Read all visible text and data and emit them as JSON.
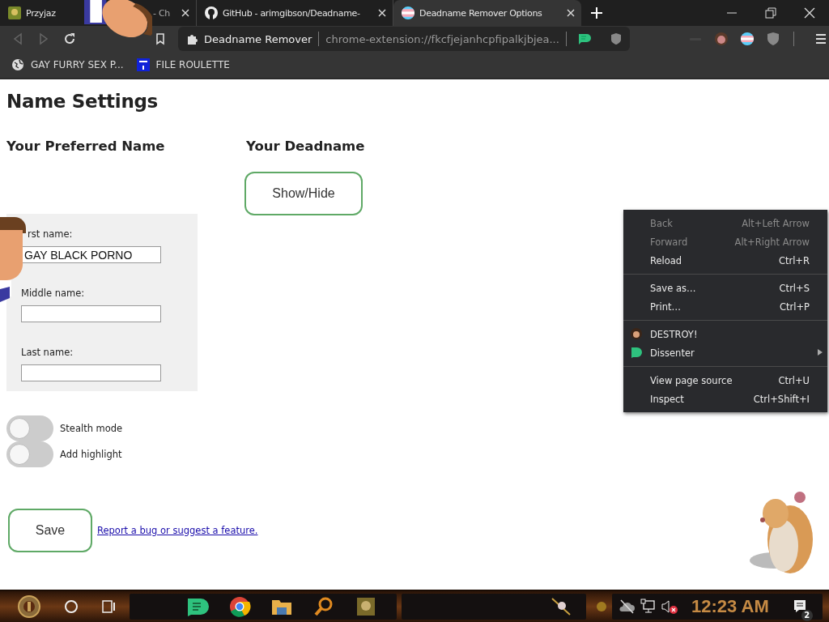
{
  "tabs": [
    {
      "title": "Przyjaz",
      "title_end": "- Ch",
      "kind": "site",
      "selected": false
    },
    {
      "title": "GitHub - arimgibson/Deadname-",
      "kind": "github",
      "selected": false
    },
    {
      "title": "Deadname Remover Options",
      "kind": "flag",
      "selected": true
    }
  ],
  "address_bar": {
    "site": "Deadname Remover",
    "url": "chrome-extension://fkcfjejanhcpfipalkjbjea..."
  },
  "bookmarks": [
    {
      "label": "GAY FURRY SEX P...",
      "kind": "globe"
    },
    {
      "label": "FILE ROULETTE",
      "kind": "badge"
    }
  ],
  "page": {
    "title": "Name Settings",
    "sections": [
      "Your Preferred Name",
      "Your Deadname"
    ],
    "show_hide_button": "Show/Hide",
    "fields": [
      {
        "label": "rst name:",
        "value": "GAY BLACK PORNO"
      },
      {
        "label": "Middle name:"
      },
      {
        "label": "Last name:"
      }
    ],
    "toggles": [
      {
        "label": "Stealth mode",
        "on": false
      },
      {
        "label": "Add highlight",
        "on": false
      }
    ],
    "save_button": "Save",
    "link": "Report a bug or suggest a feature."
  },
  "context_menu": {
    "groups": [
      [
        {
          "label": "Back",
          "shortcut": "Alt+Left Arrow",
          "kind": "command",
          "disabled": true,
          "submenu": false
        },
        {
          "label": "Forward",
          "shortcut": "Alt+Right Arrow",
          "kind": "command",
          "disabled": true,
          "submenu": false
        },
        {
          "label": "Reload",
          "shortcut": "Ctrl+R",
          "kind": "command",
          "disabled": false,
          "submenu": false
        }
      ],
      [
        {
          "label": "Save as…",
          "shortcut": "Ctrl+S",
          "kind": "command",
          "disabled": false,
          "submenu": false
        },
        {
          "label": "Print…",
          "shortcut": "Ctrl+P",
          "kind": "command",
          "disabled": false,
          "submenu": false
        }
      ],
      [
        {
          "label": "DESTROY!",
          "kind": "avatar",
          "disabled": false,
          "submenu": false
        },
        {
          "label": "Dissenter",
          "kind": "app",
          "disabled": false,
          "submenu": true
        }
      ],
      [
        {
          "label": "View page source",
          "shortcut": "Ctrl+U",
          "kind": "command",
          "disabled": false,
          "submenu": false
        },
        {
          "label": "Inspect",
          "shortcut": "Ctrl+Shift+I",
          "kind": "command",
          "disabled": false,
          "submenu": false
        }
      ]
    ]
  },
  "taskbar": {
    "clock": "12:23 AM",
    "notification_count": "2"
  }
}
